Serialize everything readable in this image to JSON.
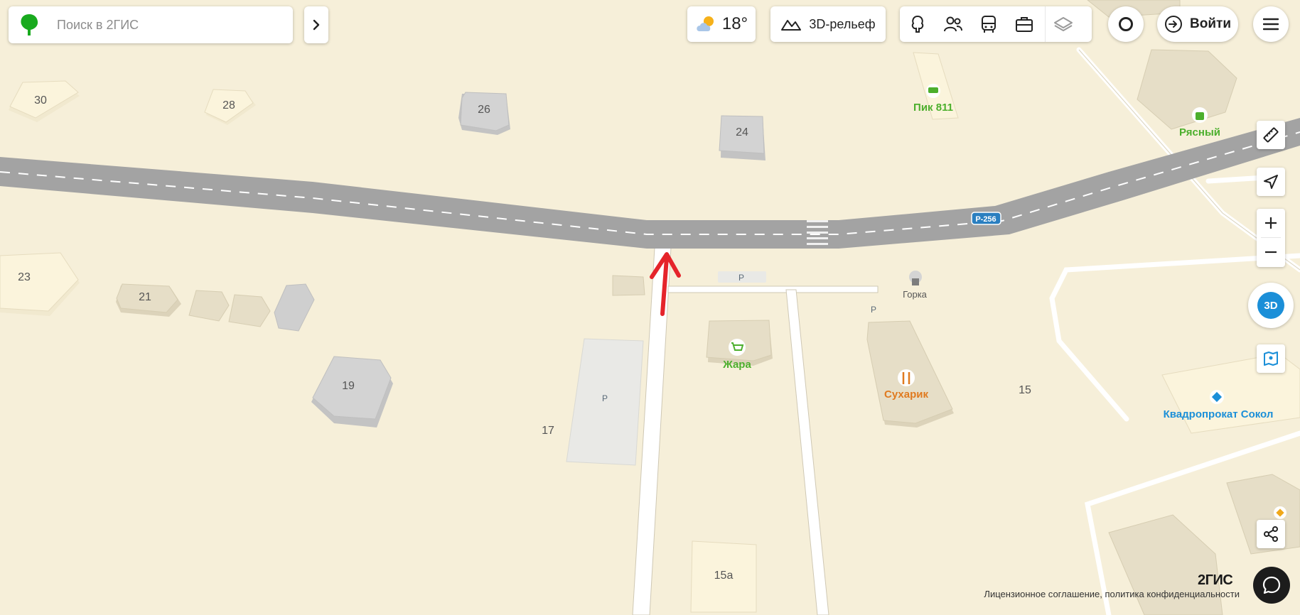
{
  "search": {
    "placeholder": "Поиск в 2ГИС"
  },
  "weather": {
    "temperature": "18°"
  },
  "relief": {
    "label": "3D-рельеф"
  },
  "login": {
    "label": "Войти"
  },
  "compass": {
    "label": "3D"
  },
  "footer": {
    "brand": "2ГИС",
    "legal": "Лицензионное соглашение, политика конфиденциальности"
  },
  "map": {
    "road_badge": "Р-256",
    "building_numbers": {
      "b30": "30",
      "b28": "28",
      "b26": "26",
      "b24": "24",
      "b23": "23",
      "b21": "21",
      "b19": "19",
      "b17": "17",
      "b15": "15",
      "b15a": "15а"
    },
    "parking_label": "P",
    "pois": {
      "pik": "Пик 811",
      "ryasny": "Рясный",
      "zhara": "Жара",
      "sukharik": "Сухарик",
      "gorka": "Горка",
      "kvadro": "Квадропрокат Сокол"
    },
    "colors": {
      "ground": "#f6efd9",
      "road": "#a3a3a3",
      "hotel_green": "#4caf2d",
      "food_orange": "#e07a1f",
      "blue_poi": "#1b8fd8",
      "marker_red": "#e5242b"
    }
  }
}
